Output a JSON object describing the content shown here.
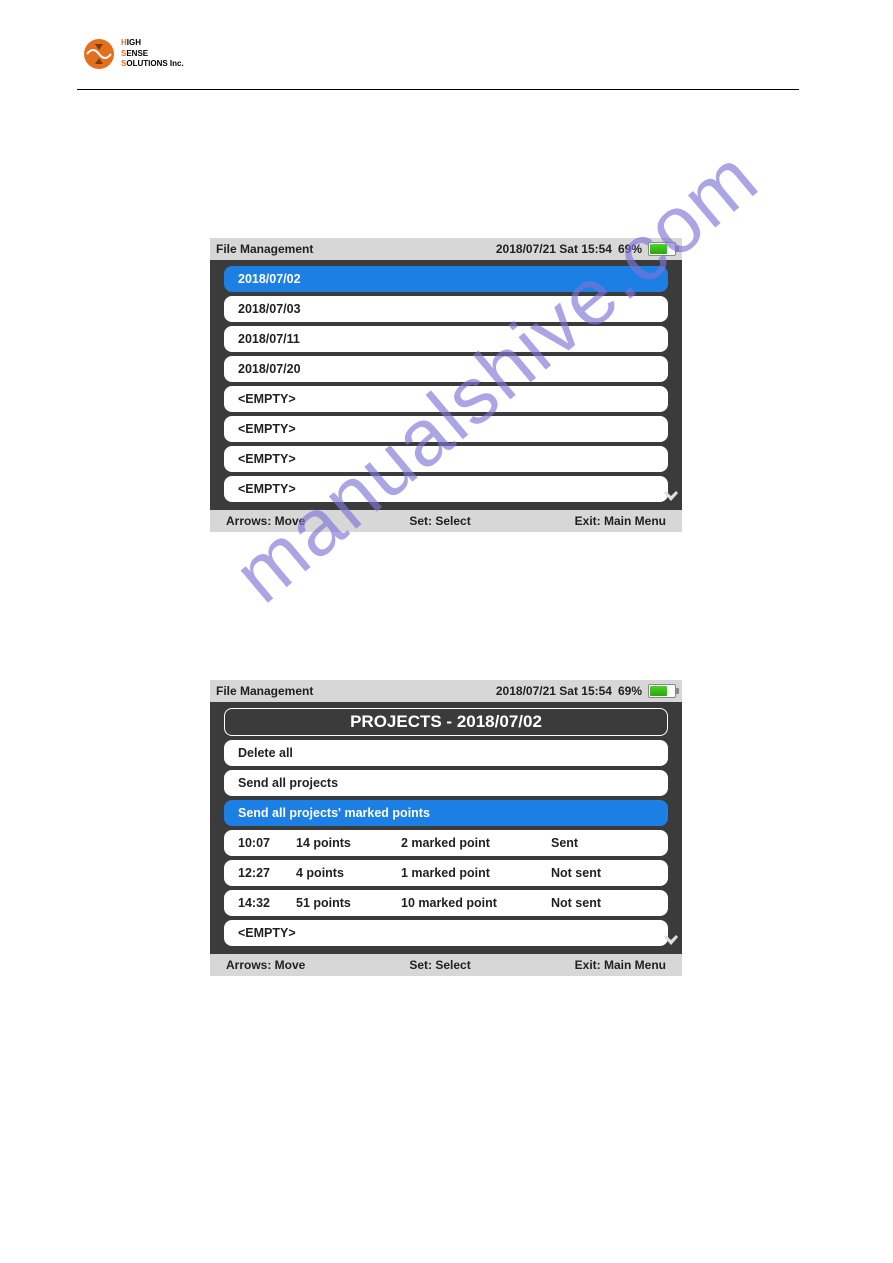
{
  "company": {
    "line1_h": "H",
    "line1_rest": "IGH",
    "line2_h": "S",
    "line2_rest": "ENSE",
    "line3_h": "S",
    "line3_rest": "OLUTIONS Inc."
  },
  "watermark": "manualshive.com",
  "screen1": {
    "title": "File Management",
    "datetime": "2018/07/21 Sat 15:54",
    "battery_pct": "69%",
    "items": [
      "2018/07/02",
      "2018/07/03",
      "2018/07/11",
      "2018/07/20",
      "<EMPTY>",
      "<EMPTY>",
      "<EMPTY>",
      "<EMPTY>"
    ],
    "footer": {
      "left": "Arrows: Move",
      "center": "Set: Select",
      "right": "Exit: Main Menu"
    }
  },
  "screen2": {
    "title": "File Management",
    "datetime": "2018/07/21 Sat 15:54",
    "battery_pct": "69%",
    "header_row": "PROJECTS - 2018/07/02",
    "actions": [
      "Delete all",
      "Send all projects",
      "Send all projects' marked points"
    ],
    "projects": [
      {
        "time": "10:07",
        "points": "14 points",
        "marked": "2 marked point",
        "status": "Sent"
      },
      {
        "time": "12:27",
        "points": "4 points",
        "marked": "1 marked point",
        "status": "Not sent"
      },
      {
        "time": "14:32",
        "points": "51 points",
        "marked": "10 marked point",
        "status": "Not sent"
      }
    ],
    "empty": "<EMPTY>",
    "footer": {
      "left": "Arrows: Move",
      "center": "Set: Select",
      "right": "Exit: Main Menu"
    }
  }
}
